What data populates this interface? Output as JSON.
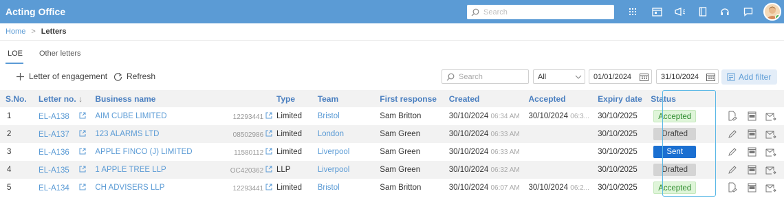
{
  "app": {
    "title": "Acting Office"
  },
  "topbar": {
    "search_placeholder": "Search",
    "icons": [
      "grid-icon",
      "calendar-icon",
      "megaphone-icon",
      "book-icon",
      "headset-icon",
      "chat-icon"
    ],
    "avatar": "user-avatar"
  },
  "breadcrumb": {
    "home": "Home",
    "separator": ">",
    "current": "Letters"
  },
  "tabs": [
    {
      "label": "LOE",
      "active": true
    },
    {
      "label": "Other letters",
      "active": false
    }
  ],
  "toolbar": {
    "add_label": "Letter of engagement",
    "refresh_label": "Refresh",
    "search_placeholder": "Search",
    "filter_select": "All",
    "date_from": "01/01/2024",
    "date_to": "31/10/2024",
    "add_filter_label": "Add filter"
  },
  "table": {
    "columns": [
      "S.No.",
      "Letter no.",
      "Business name",
      "Type",
      "Team",
      "First response",
      "Created",
      "Accepted",
      "Expiry date",
      "Status"
    ],
    "rows": [
      {
        "sno": "1",
        "letter": "EL-A138",
        "business": "AIM CUBE LIMITED",
        "regno": "12293441",
        "type": "Limited",
        "team": "Bristol",
        "first": "Sam Britton",
        "created_date": "30/10/2024",
        "created_time": "06:34 AM",
        "accepted_date": "30/10/2024",
        "accepted_time": "06:3...",
        "expiry": "30/10/2025",
        "status": "Accepted",
        "first_action": "file-signature-icon"
      },
      {
        "sno": "2",
        "letter": "EL-A137",
        "business": "123 ALARMS LTD",
        "regno": "08502986",
        "type": "Limited",
        "team": "London",
        "first": "Sam Green",
        "created_date": "30/10/2024",
        "created_time": "06:33 AM",
        "accepted_date": "",
        "accepted_time": "",
        "expiry": "30/10/2025",
        "status": "Drafted",
        "first_action": "pencil-icon"
      },
      {
        "sno": "3",
        "letter": "EL-A136",
        "business": "APPLE FINCO (J) LIMITED",
        "regno": "11580112",
        "type": "Limited",
        "team": "Liverpool",
        "first": "Sam Green",
        "created_date": "30/10/2024",
        "created_time": "06:33 AM",
        "accepted_date": "",
        "accepted_time": "",
        "expiry": "30/10/2025",
        "status": "Sent",
        "first_action": "pencil-icon"
      },
      {
        "sno": "4",
        "letter": "EL-A135",
        "business": "1 APPLE TREE LLP",
        "regno": "OC420362",
        "type": "LLP",
        "team": "Liverpool",
        "first": "Sam Green",
        "created_date": "30/10/2024",
        "created_time": "06:32 AM",
        "accepted_date": "",
        "accepted_time": "",
        "expiry": "30/10/2025",
        "status": "Drafted",
        "first_action": "pencil-icon"
      },
      {
        "sno": "5",
        "letter": "EL-A134",
        "business": "CH ADVISERS LLP",
        "regno": "12293441",
        "type": "Limited",
        "team": "Bristol",
        "first": "Sam Britton",
        "created_date": "30/10/2024",
        "created_time": "06:07 AM",
        "accepted_date": "30/10/2024",
        "accepted_time": "06:2...",
        "expiry": "30/10/2025",
        "status": "Accepted",
        "first_action": "file-signature-icon"
      }
    ]
  },
  "colors": {
    "header": "#5b9bd5",
    "accent": "#4a7fc0",
    "sent": "#1a6fd1",
    "accepted": "#dff5d9",
    "drafted": "#d4d4d4"
  }
}
